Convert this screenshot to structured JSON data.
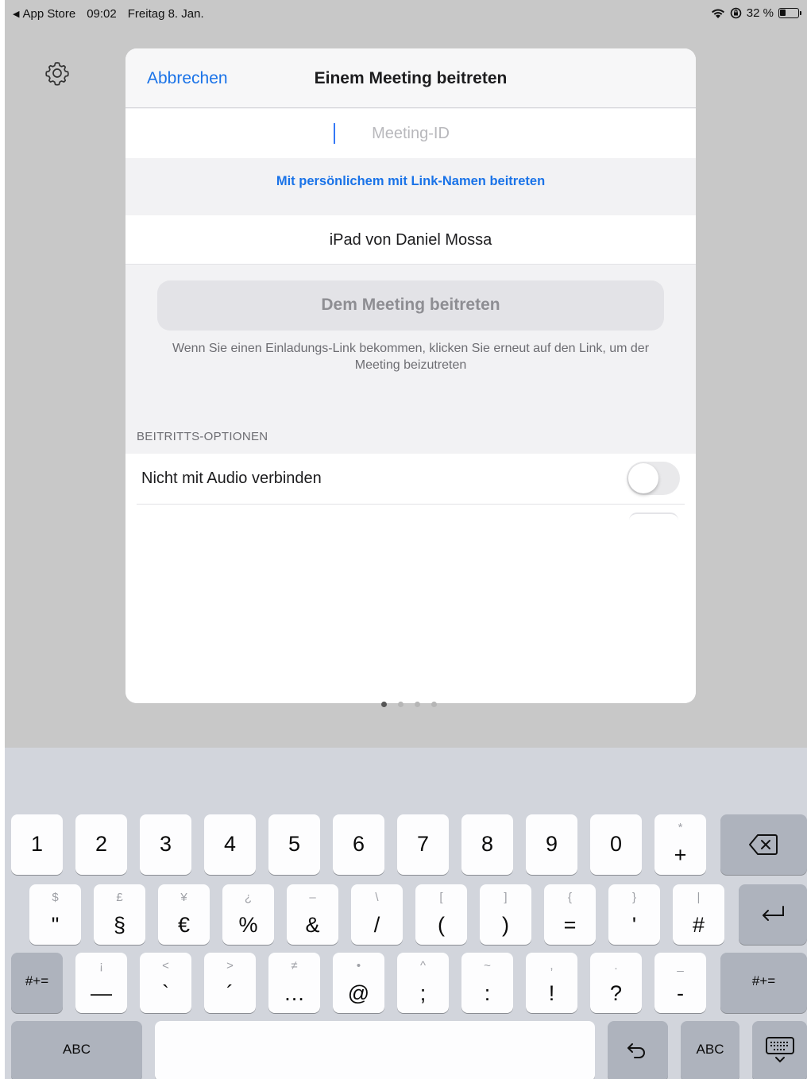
{
  "status_bar": {
    "back_app": "App Store",
    "time": "09:02",
    "date": "Freitag 8. Jan.",
    "battery": "32 %"
  },
  "dialog": {
    "cancel_label": "Abbrechen",
    "title": "Einem Meeting beitreten",
    "meeting_id_placeholder": "Meeting-ID",
    "link_name_label": "Mit persönlichem mit Link-Namen beitreten",
    "device_name": "iPad von Daniel Mossa",
    "join_button": "Dem Meeting beitreten",
    "hint": "Wenn Sie einen Einladungs-Link bekommen, klicken Sie erneut auf den Link, um der Meeting beizutreten",
    "options_header": "BEITRITTS-OPTIONEN",
    "options": [
      {
        "label": "Nicht mit Audio verbinden",
        "enabled": false
      }
    ]
  },
  "keyboard": {
    "row1": [
      {
        "main": "1"
      },
      {
        "main": "2"
      },
      {
        "main": "3"
      },
      {
        "main": "4"
      },
      {
        "main": "5"
      },
      {
        "main": "6"
      },
      {
        "main": "7"
      },
      {
        "main": "8"
      },
      {
        "main": "9"
      },
      {
        "main": "0"
      },
      {
        "main": "+",
        "sub": "*"
      }
    ],
    "row2": [
      {
        "main": "\"",
        "sub": "$"
      },
      {
        "main": "§",
        "sub": "£"
      },
      {
        "main": "€",
        "sub": "¥"
      },
      {
        "main": "%",
        "sub": "¿"
      },
      {
        "main": "&",
        "sub": "–"
      },
      {
        "main": "/",
        "sub": "\\"
      },
      {
        "main": "(",
        "sub": "["
      },
      {
        "main": ")",
        "sub": "]"
      },
      {
        "main": "=",
        "sub": "{"
      },
      {
        "main": "'",
        "sub": "}"
      },
      {
        "main": "#",
        "sub": "|"
      }
    ],
    "row3": [
      {
        "main": "—",
        "sub": "¡"
      },
      {
        "main": "`",
        "sub": "<"
      },
      {
        "main": "´",
        "sub": ">"
      },
      {
        "main": "…",
        "sub": "≠"
      },
      {
        "main": "@",
        "sub": "•"
      },
      {
        "main": ";",
        "sub": "^"
      },
      {
        "main": ":",
        "sub": "~"
      },
      {
        "main": "!",
        "sub": ","
      },
      {
        "main": "?",
        "sub": "."
      },
      {
        "main": "-",
        "sub": "_"
      }
    ],
    "sym_label": "#+=",
    "abc_label": "ABC"
  }
}
